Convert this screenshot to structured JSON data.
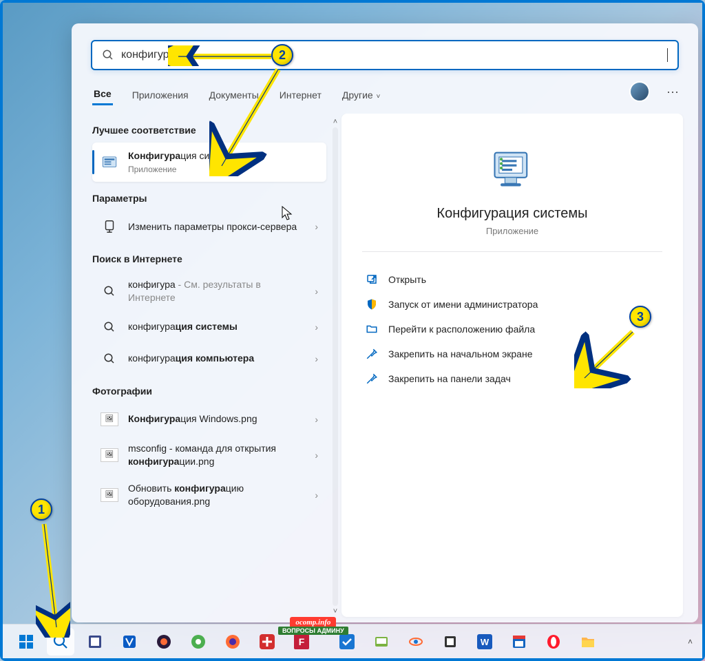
{
  "search": {
    "query": "конфигура"
  },
  "tabs": {
    "all": "Все",
    "apps": "Приложения",
    "docs": "Документы",
    "internet": "Интернет",
    "others": "Другие"
  },
  "sections": {
    "best_match": "Лучшее соответствие",
    "settings": "Параметры",
    "web": "Поиск в Интернете",
    "photos": "Фотографии"
  },
  "best_match": {
    "title_pre": "Конфигура",
    "title_post": "ция системы",
    "subtitle": "Приложение"
  },
  "settings_items": [
    {
      "label": "Изменить параметры прокси-сервера"
    }
  ],
  "web_items": [
    {
      "pre": "конфигура",
      "post": "",
      "hint": " - См. результаты в Интернете"
    },
    {
      "pre": "конфигура",
      "post": "ция системы",
      "hint": ""
    },
    {
      "pre": "конфигура",
      "post": "ция компьютера",
      "hint": ""
    }
  ],
  "photo_items": [
    {
      "pre": "Конфигура",
      "post": "ция Windows.png"
    },
    {
      "pre_text": "msconfig - команда для открытия ",
      "pre": "конфигура",
      "post": "ции.png"
    },
    {
      "pre_text": "Обновить ",
      "pre": "конфигура",
      "post": "цию оборудования.png"
    }
  ],
  "detail": {
    "title": "Конфигурация системы",
    "subtitle": "Приложение"
  },
  "actions": [
    {
      "icon": "open",
      "label": "Открыть"
    },
    {
      "icon": "admin",
      "label": "Запуск от имени администратора"
    },
    {
      "icon": "folder",
      "label": "Перейти к расположению файла"
    },
    {
      "icon": "pin",
      "label": "Закрепить на начальном экране"
    },
    {
      "icon": "pin",
      "label": "Закрепить на панели задач"
    }
  ],
  "callouts": {
    "c1": "1",
    "c2": "2",
    "c3": "3"
  },
  "watermark": {
    "line1": "ocomp.info",
    "line2": "ВОПРОСЫ АДМИНУ"
  }
}
